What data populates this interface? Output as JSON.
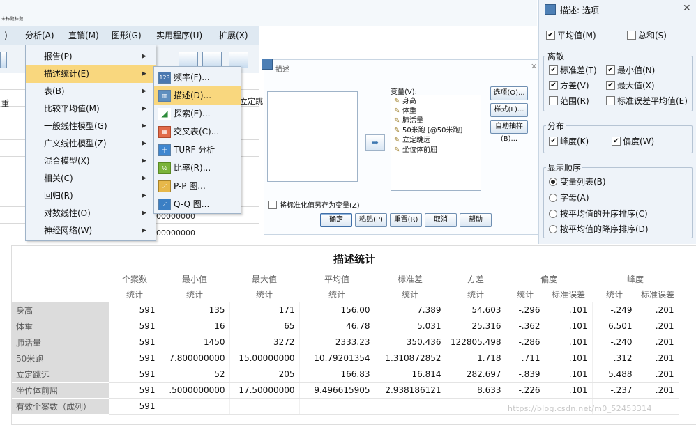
{
  "window": {
    "tiny_title": "未标题标题"
  },
  "menubar": {
    "items": [
      {
        "label": ")"
      },
      {
        "label": "分析(A)"
      },
      {
        "label": "直销(M)"
      },
      {
        "label": "图形(G)"
      },
      {
        "label": "实用程序(U)"
      },
      {
        "label": "扩展(X)"
      }
    ]
  },
  "grid": {
    "header_fragment": "立定跳",
    "left_fragment": "重",
    "cell_values": [
      "00000000",
      "00000000"
    ]
  },
  "analyze_menu": {
    "items": [
      {
        "label": "报告(P)"
      },
      {
        "label": "描述统计(E)"
      },
      {
        "label": "表(B)"
      },
      {
        "label": "比较平均值(M)"
      },
      {
        "label": "一般线性模型(G)"
      },
      {
        "label": "广义线性模型(Z)"
      },
      {
        "label": "混合模型(X)"
      },
      {
        "label": "相关(C)"
      },
      {
        "label": "回归(R)"
      },
      {
        "label": "对数线性(O)"
      },
      {
        "label": "神经网络(W)"
      }
    ]
  },
  "descriptive_submenu": {
    "items": [
      {
        "label": "频率(F)...",
        "icon": "frequencies-icon"
      },
      {
        "label": "描述(D)...",
        "icon": "descriptives-icon"
      },
      {
        "label": "探索(E)...",
        "icon": "explore-icon"
      },
      {
        "label": "交叉表(C)...",
        "icon": "crosstabs-icon"
      },
      {
        "label": "TURF 分析",
        "icon": "turf-icon"
      },
      {
        "label": "比率(R)...",
        "icon": "ratio-icon"
      },
      {
        "label": "P-P 图...",
        "icon": "pp-plot-icon"
      },
      {
        "label": "Q-Q 图...",
        "icon": "qq-plot-icon"
      }
    ]
  },
  "descriptives_dialog": {
    "title": "描述",
    "variables_label": "变量(V):",
    "variables": [
      "身高",
      "体重",
      "肺活量",
      "50米跑 [@50米跑]",
      "立定跳远",
      "坐位体前屈"
    ],
    "side_buttons": [
      "选项(O)...",
      "样式(L)...",
      "自助抽样(B)..."
    ],
    "save_checkbox_label": "将标准化值另存为变量(Z)",
    "bottom_buttons": [
      "确定",
      "粘贴(P)",
      "重置(R)",
      "取消",
      "帮助"
    ]
  },
  "options_dialog": {
    "title": "描述: 选项",
    "mean": {
      "label": "平均值(M)",
      "checked": true
    },
    "sum": {
      "label": "总和(S)",
      "checked": false
    },
    "dispersion_group": "离散",
    "dispersion": [
      {
        "label": "标准差(T)",
        "checked": true
      },
      {
        "label": "最小值(N)",
        "checked": true
      },
      {
        "label": "方差(V)",
        "checked": true
      },
      {
        "label": "最大值(X)",
        "checked": true
      },
      {
        "label": "范围(R)",
        "checked": false
      },
      {
        "label": "标准误差平均值(E)",
        "checked": false
      }
    ],
    "distribution_group": "分布",
    "distribution": [
      {
        "label": "峰度(K)",
        "checked": true
      },
      {
        "label": "偏度(W)",
        "checked": true
      }
    ],
    "display_order_group": "显示顺序",
    "display_order": [
      {
        "label": "变量列表(B)",
        "selected": true
      },
      {
        "label": "字母(A)",
        "selected": false
      },
      {
        "label": "按平均值的升序排序(C)",
        "selected": false
      },
      {
        "label": "按平均值的降序排序(D)",
        "selected": false
      }
    ]
  },
  "output_table": {
    "title": "描述统计",
    "header_row1": [
      "个案数",
      "最小值",
      "最大值",
      "平均值",
      "标准差",
      "方差",
      "偏度",
      "峰度"
    ],
    "header_row2": [
      "统计",
      "统计",
      "统计",
      "统计",
      "统计",
      "统计",
      "统计",
      "标准误差",
      "统计",
      "标准误差"
    ],
    "rows": [
      {
        "name": "身高",
        "values": [
          "591",
          "135",
          "171",
          "156.00",
          "7.389",
          "54.603",
          "-.296",
          ".101",
          "-.249",
          ".201"
        ]
      },
      {
        "name": "体重",
        "values": [
          "591",
          "16",
          "65",
          "46.78",
          "5.031",
          "25.316",
          "-.362",
          ".101",
          "6.501",
          ".201"
        ]
      },
      {
        "name": "肺活量",
        "values": [
          "591",
          "1450",
          "3272",
          "2333.23",
          "350.436",
          "122805.498",
          "-.286",
          ".101",
          "-.240",
          ".201"
        ]
      },
      {
        "name": "50米跑",
        "values": [
          "591",
          "7.800000000",
          "15.00000000",
          "10.79201354",
          "1.310872852",
          "1.718",
          ".711",
          ".101",
          ".312",
          ".201"
        ]
      },
      {
        "name": "立定跳远",
        "values": [
          "591",
          "52",
          "205",
          "166.83",
          "16.814",
          "282.697",
          "-.839",
          ".101",
          "5.488",
          ".201"
        ]
      },
      {
        "name": "坐位体前屈",
        "values": [
          "591",
          ".5000000000",
          "17.50000000",
          "9.496615905",
          "2.938186121",
          "8.633",
          "-.226",
          ".101",
          "-.237",
          ".201"
        ]
      },
      {
        "name": "有效个案数（成列）",
        "values": [
          "591",
          "",
          "",
          "",
          "",
          "",
          "",
          "",
          "",
          ""
        ]
      }
    ]
  },
  "watermark": "https://blog.csdn.net/m0_52453314"
}
